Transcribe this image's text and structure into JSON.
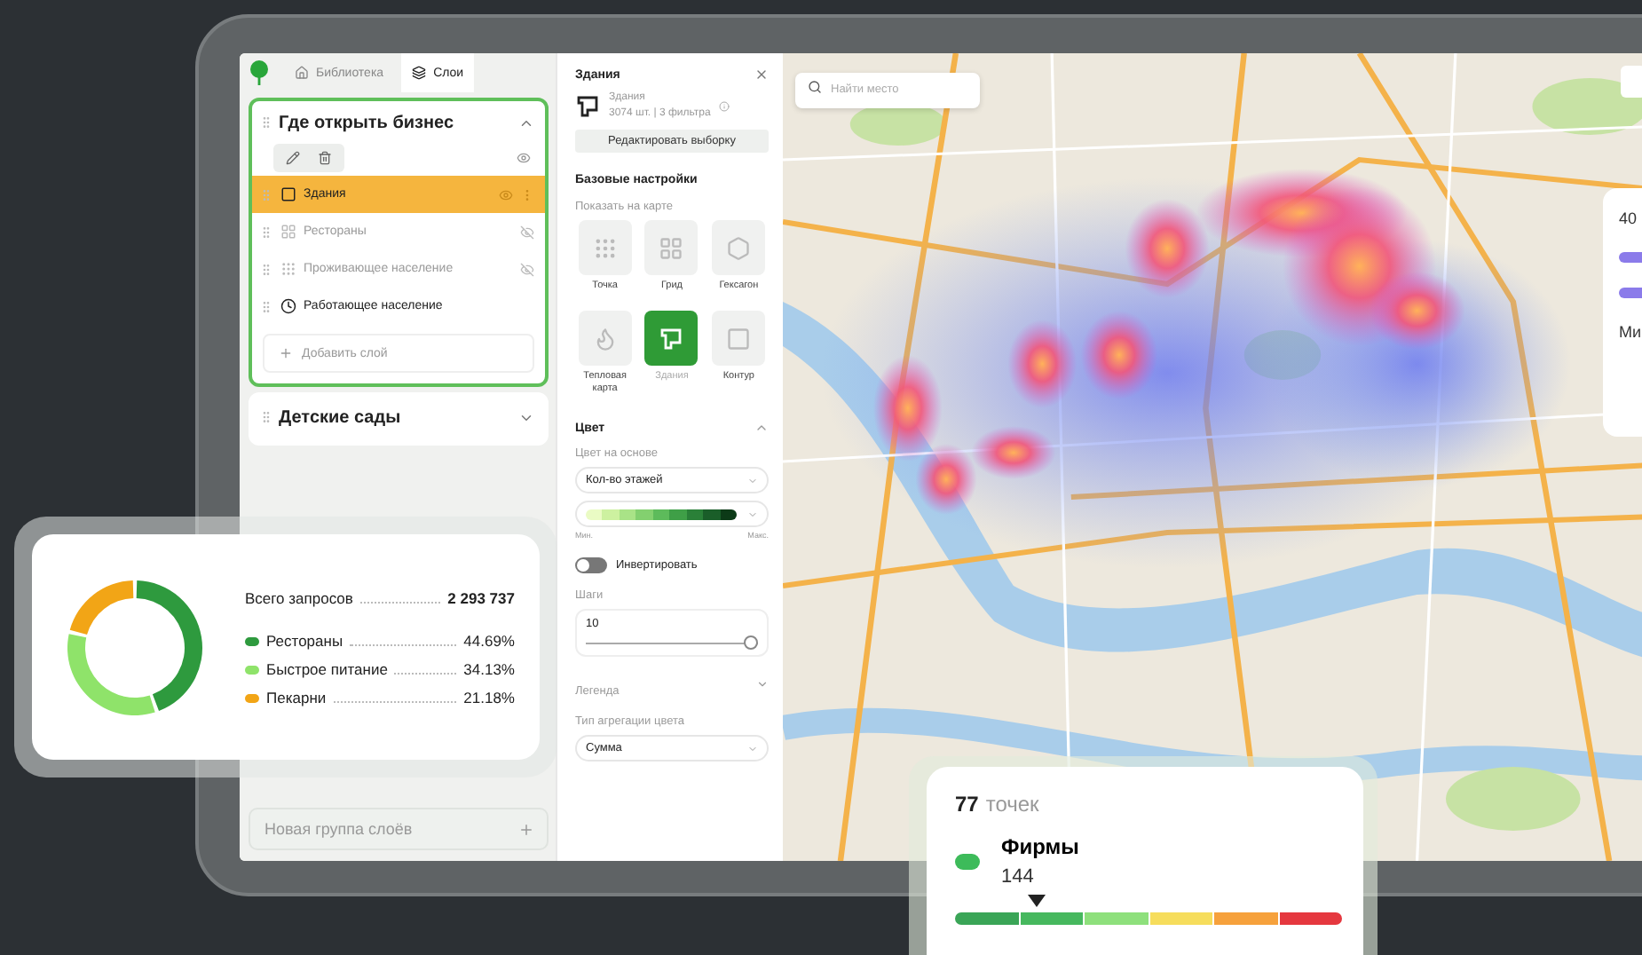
{
  "tabs": [
    {
      "label": "Библиотека",
      "kind": "home",
      "selected": false
    },
    {
      "label": "Слои",
      "kind": "layers",
      "selected": true
    }
  ],
  "layer_groups": [
    {
      "title": "Где открыть бизнес",
      "expanded": true,
      "selected": true,
      "layers": [
        {
          "name": "Здания",
          "kind": "building",
          "selected": true,
          "visible": true
        },
        {
          "name": "Рестораны",
          "kind": "grid",
          "selected": false,
          "visible": false
        },
        {
          "name": "Проживающее население",
          "kind": "dots",
          "selected": false,
          "visible": false
        },
        {
          "name": "Работающее население",
          "kind": "clock",
          "selected": false,
          "visible": true
        }
      ],
      "add_label": "Добавить слой"
    },
    {
      "title": "Детские сады",
      "expanded": false,
      "selected": false
    }
  ],
  "new_group": {
    "placeholder": "Новая группа слоёв"
  },
  "settings": {
    "title": "Здания",
    "object_name": "Здания",
    "object_meta": "3074 шт. | 3 фильтра",
    "edit_button": "Редактировать выборку",
    "section_title": "Базовые настройки",
    "show_label": "Показать на карте",
    "display_types": [
      {
        "label": "Точка",
        "kind": "point",
        "selected": false
      },
      {
        "label": "Грид",
        "kind": "grid",
        "selected": false
      },
      {
        "label": "Гексагон",
        "kind": "hexagon",
        "selected": false
      },
      {
        "label": "Тепловая карта",
        "kind": "heat",
        "selected": false
      },
      {
        "label": "Здания",
        "kind": "building",
        "selected": true
      },
      {
        "label": "Контур",
        "kind": "contour",
        "selected": false
      }
    ],
    "color": {
      "title": "Цвет",
      "expanded": true,
      "basis_label": "Цвет на основе",
      "basis_value": "Кол-во этажей",
      "min_label": "Мин.",
      "max_label": "Макс.",
      "invert": {
        "label": "Инвертировать",
        "on": false
      },
      "steps": {
        "label": "Шаги",
        "value": "10",
        "level": 1
      },
      "legend": {
        "label": "Легенда",
        "expanded": false
      },
      "aggregation": {
        "label": "Тип агрегации цвета",
        "value": "Сумма"
      }
    }
  },
  "map": {
    "search": {
      "placeholder": "Найти место"
    },
    "side_card": {
      "value": "40",
      "label": "Ми"
    }
  },
  "requests_card": {
    "total_label": "Всего запросов",
    "total": "2 293 737",
    "items": [
      {
        "label": "Рестораны",
        "value": "44.69%",
        "color": "#2e9a3e"
      },
      {
        "label": "Быстрое питание",
        "value": "34.13%",
        "color": "#8fe36a"
      },
      {
        "label": "Пекарни",
        "value": "21.18%",
        "color": "#f2a516"
      }
    ],
    "chart_data": {
      "type": "donut",
      "values": [
        44.69,
        34.13,
        21.18
      ]
    }
  },
  "points_card": {
    "count": "77",
    "count_label": "точек",
    "layer_name": "Фирмы",
    "layer_value": "144",
    "level": 0.21
  }
}
